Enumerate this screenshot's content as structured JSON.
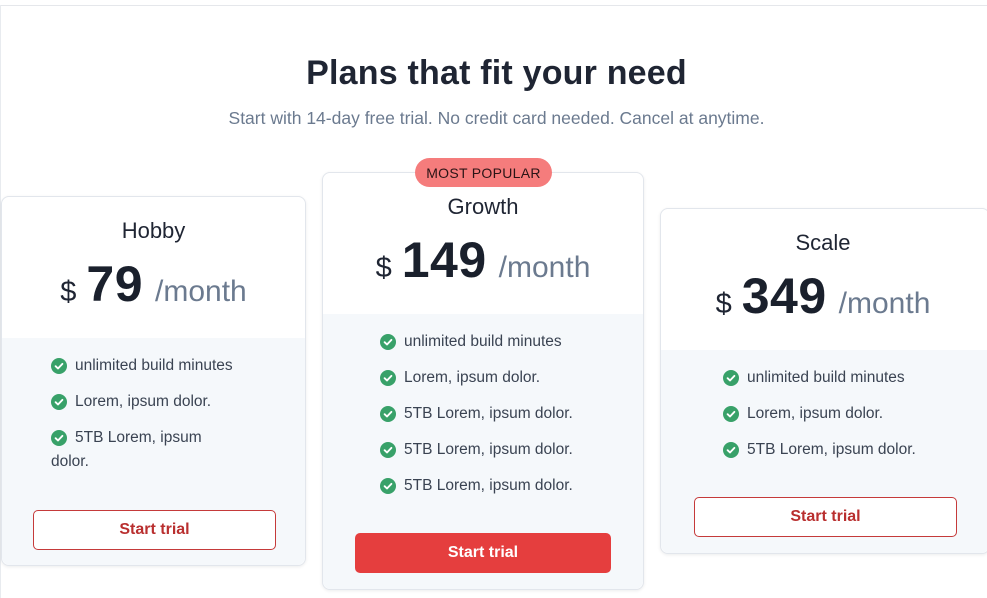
{
  "header": {
    "title": "Plans that fit your need",
    "subtitle": "Start with 14-day free trial. No credit card needed. Cancel at anytime."
  },
  "colors": {
    "accent": "#e53e3e",
    "badge": "#f57c7c",
    "check": "#38a169"
  },
  "plans": [
    {
      "name": "Hobby",
      "currency": "$",
      "price": "79",
      "period": "/month",
      "features": [
        "unlimited build minutes",
        "Lorem, ipsum dolor.",
        "5TB Lorem, ipsum dolor."
      ],
      "cta": "Start trial"
    },
    {
      "name": "Growth",
      "badge": "MOST POPULAR",
      "currency": "$",
      "price": "149",
      "period": "/month",
      "features": [
        "unlimited build minutes",
        "Lorem, ipsum dolor.",
        "5TB Lorem, ipsum dolor.",
        "5TB Lorem, ipsum dolor.",
        "5TB Lorem, ipsum dolor."
      ],
      "cta": "Start trial"
    },
    {
      "name": "Scale",
      "currency": "$",
      "price": "349",
      "period": "/month",
      "features": [
        "unlimited build minutes",
        "Lorem, ipsum dolor.",
        "5TB Lorem, ipsum dolor."
      ],
      "cta": "Start trial"
    }
  ],
  "icons": {
    "feature": "check-circle-icon"
  }
}
